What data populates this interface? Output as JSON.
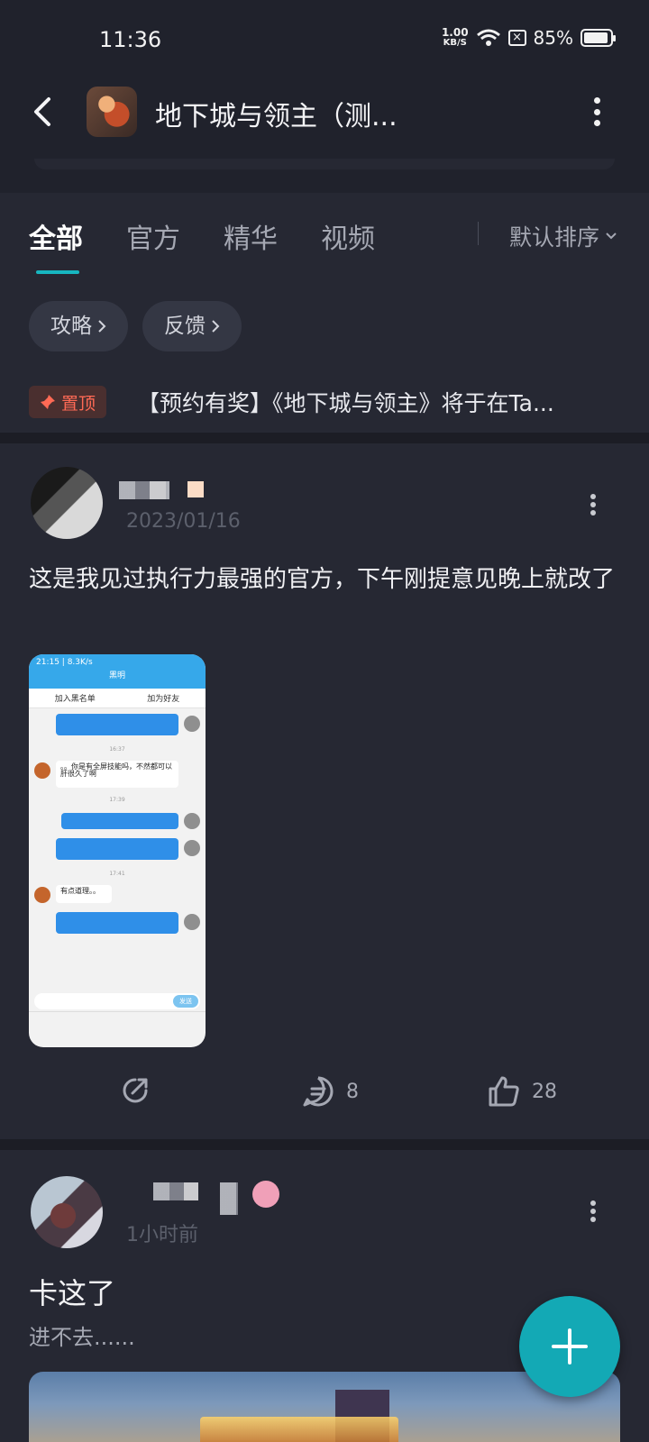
{
  "status_bar": {
    "time": "11:36",
    "net_speed_value": "1.00",
    "net_speed_unit": "KB/S",
    "battery": "85%",
    "battery_level": 0.85
  },
  "header": {
    "title": "地下城与领主（测..."
  },
  "tabs": [
    {
      "label": "全部",
      "active": true
    },
    {
      "label": "官方",
      "active": false
    },
    {
      "label": "精华",
      "active": false
    },
    {
      "label": "视频",
      "active": false
    }
  ],
  "sort": {
    "label": "默认排序"
  },
  "chips": [
    {
      "label": "攻略"
    },
    {
      "label": "反馈"
    }
  ],
  "pinned": {
    "badge": "置顶",
    "text": "【预约有奖】《地下城与领主》将于在Ta..."
  },
  "posts": [
    {
      "date": "2023/01/16",
      "body": "这是我见过执行力最强的官方，下午刚提意见晚上就改了",
      "screenshot": {
        "status": "21:15 | 8.3K/s",
        "name": "黑明",
        "btn_block": "加入黑名单",
        "btn_friend": "加为好友",
        "msg_in_1": "。。你是有全屏技能吗，不然都可以肝很久了啊",
        "msg_in_2": "有点道理。。",
        "time_1": "16:37",
        "time_2": "17:39",
        "time_3": "17:41",
        "send": "发送"
      },
      "actions": {
        "comments": "8",
        "likes": "28"
      }
    },
    {
      "date": "1小时前",
      "title": "卡这了",
      "subtitle": "进不去......"
    }
  ],
  "colors": {
    "accent": "#17b6c0",
    "fab": "#13a9b5",
    "pin": "#ff6a55"
  },
  "icons": [
    "back-arrow-icon",
    "more-vertical-icon",
    "chevron-down-icon",
    "chevron-right-icon",
    "pin-icon",
    "share-icon",
    "comment-icon",
    "thumbs-up-icon",
    "plus-icon"
  ]
}
